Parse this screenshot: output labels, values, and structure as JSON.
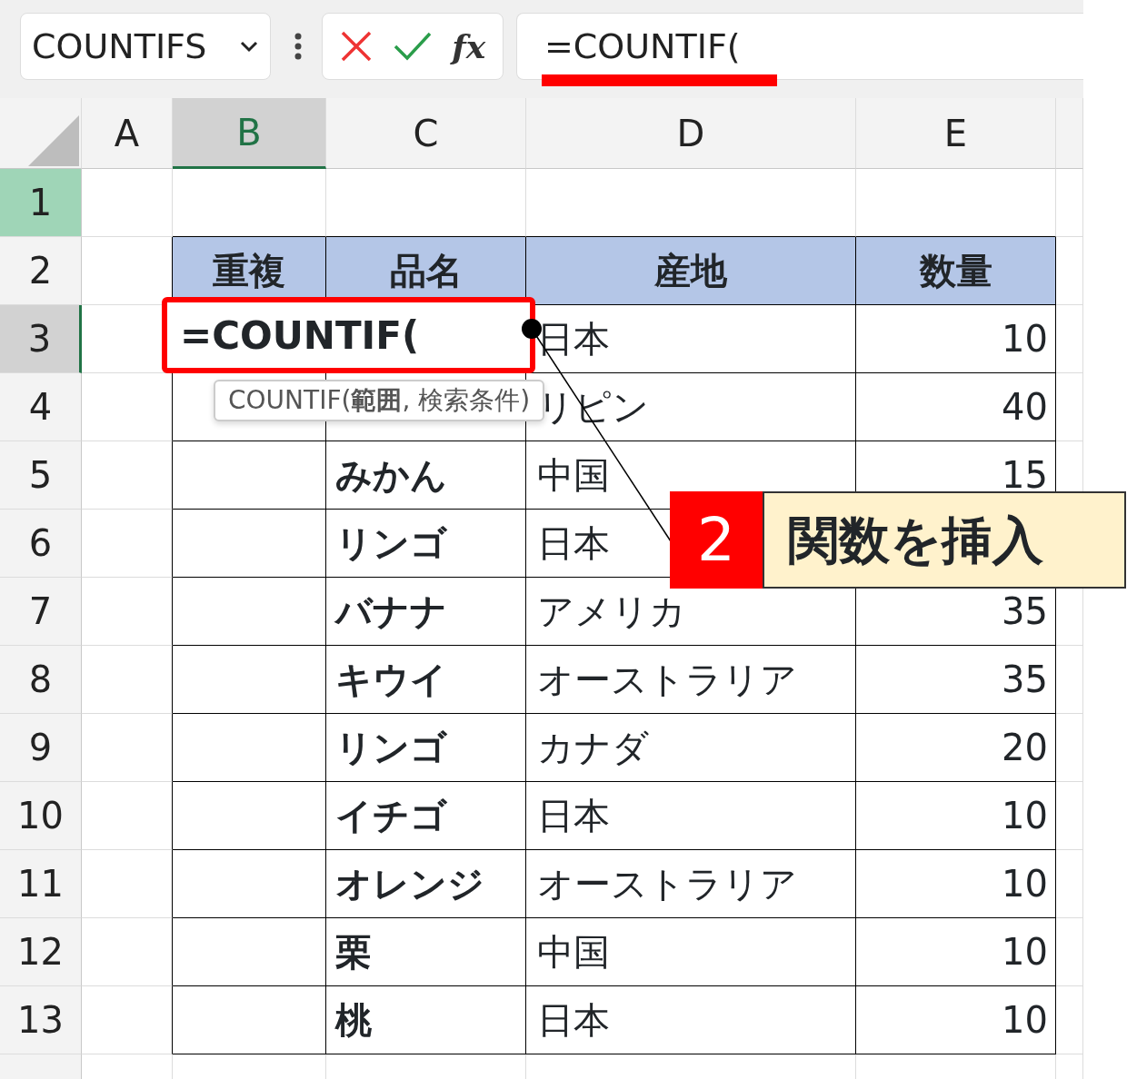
{
  "name_box": {
    "value": "COUNTIFS"
  },
  "formula_bar": {
    "function_label": "fx",
    "formula": "=COUNTIF(",
    "underlined": true
  },
  "columns": [
    {
      "label": "A",
      "selected": false
    },
    {
      "label": "B",
      "selected": true
    },
    {
      "label": "C",
      "selected": false
    },
    {
      "label": "D",
      "selected": false
    },
    {
      "label": "E",
      "selected": false
    }
  ],
  "row_headers": [
    {
      "label": "1",
      "selected": false,
      "shaded": true
    },
    {
      "label": "2",
      "selected": false,
      "shaded": false
    },
    {
      "label": "3",
      "selected": true,
      "shaded": false
    },
    {
      "label": "4",
      "selected": false,
      "shaded": false
    },
    {
      "label": "5",
      "selected": false,
      "shaded": false
    },
    {
      "label": "6",
      "selected": false,
      "shaded": false
    },
    {
      "label": "7",
      "selected": false,
      "shaded": false
    },
    {
      "label": "8",
      "selected": false,
      "shaded": false
    },
    {
      "label": "9",
      "selected": false,
      "shaded": false
    },
    {
      "label": "10",
      "selected": false,
      "shaded": false
    },
    {
      "label": "11",
      "selected": false,
      "shaded": false
    },
    {
      "label": "12",
      "selected": false,
      "shaded": false
    },
    {
      "label": "13",
      "selected": false,
      "shaded": false
    }
  ],
  "table": {
    "header": [
      "重複",
      "品名",
      "産地",
      "数量"
    ],
    "rows": [
      [
        null,
        null,
        "日本",
        "10"
      ],
      [
        null,
        null,
        "リピン",
        "40"
      ],
      [
        null,
        "みかん",
        "中国",
        "15"
      ],
      [
        null,
        "リンゴ",
        "日本",
        null
      ],
      [
        null,
        "バナナ",
        "アメリカ",
        "35"
      ],
      [
        null,
        "キウイ",
        "オーストラリア",
        "35"
      ],
      [
        null,
        "リンゴ",
        "カナダ",
        "20"
      ],
      [
        null,
        "イチゴ",
        "日本",
        "10"
      ],
      [
        null,
        "オレンジ",
        "オーストラリア",
        "10"
      ],
      [
        null,
        "栗",
        "中国",
        "10"
      ],
      [
        null,
        "桃",
        "日本",
        "10"
      ]
    ]
  },
  "active_cell": {
    "value": "=COUNTIF(",
    "highlighted": true
  },
  "tooltip": {
    "text": "COUNTIF(**範囲**, 検索条件)"
  },
  "callout": {
    "number": "2",
    "label": "関数を挿入"
  }
}
